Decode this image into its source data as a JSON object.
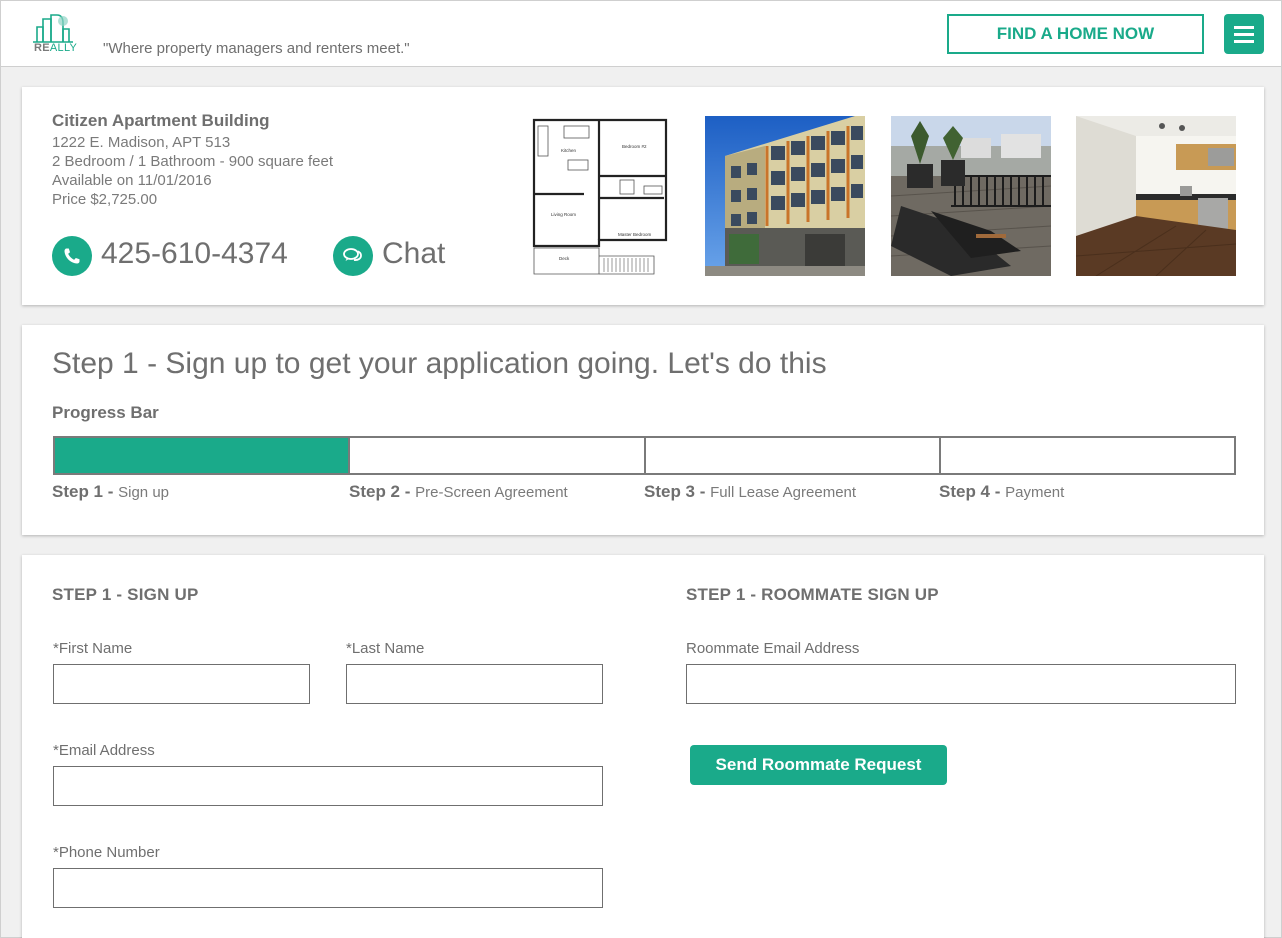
{
  "header": {
    "logo_text_re": "RE",
    "logo_text_ally": "ALLY",
    "tagline": "\"Where property managers and renters meet.\"",
    "find_button": "FIND A HOME NOW",
    "accent": "#1aaa8a"
  },
  "listing": {
    "name": "Citizen Apartment Building",
    "address": "1222 E. Madison, APT 513",
    "details": "2 Bedroom / 1 Bathroom - 900 square feet",
    "available": "Available on 11/01/2016",
    "price": "Price $2,725.00",
    "phone": "425-610-4374",
    "chat": "Chat",
    "floorplan_labels": {
      "kitchen": "Kitchen",
      "bedroom2": "Bedroom #2",
      "living": "Living Room",
      "master": "Master Bedroom",
      "deck": "Deck"
    }
  },
  "progress": {
    "title": "Step 1 - Sign up to get your application going. Let's do this",
    "label": "Progress Bar",
    "completed_steps": 1,
    "total_steps": 4,
    "steps": [
      {
        "num": "Step 1 - ",
        "name": "Sign up"
      },
      {
        "num": "Step 2 - ",
        "name": "Pre-Screen Agreement"
      },
      {
        "num": "Step 3 - ",
        "name": "Full Lease Agreement"
      },
      {
        "num": "Step 4 - ",
        "name": "Payment"
      }
    ]
  },
  "signup": {
    "title": "STEP 1 - SIGN UP",
    "first_name_label": "*First Name",
    "last_name_label": "*Last Name",
    "email_label": "*Email Address",
    "phone_label": "*Phone Number",
    "first_name_value": "",
    "last_name_value": "",
    "email_value": "",
    "phone_value": ""
  },
  "roommate": {
    "title": "STEP 1 - ROOMMATE SIGN UP",
    "email_label": "Roommate Email Address",
    "email_value": "",
    "send_button": "Send Roommate Request"
  }
}
